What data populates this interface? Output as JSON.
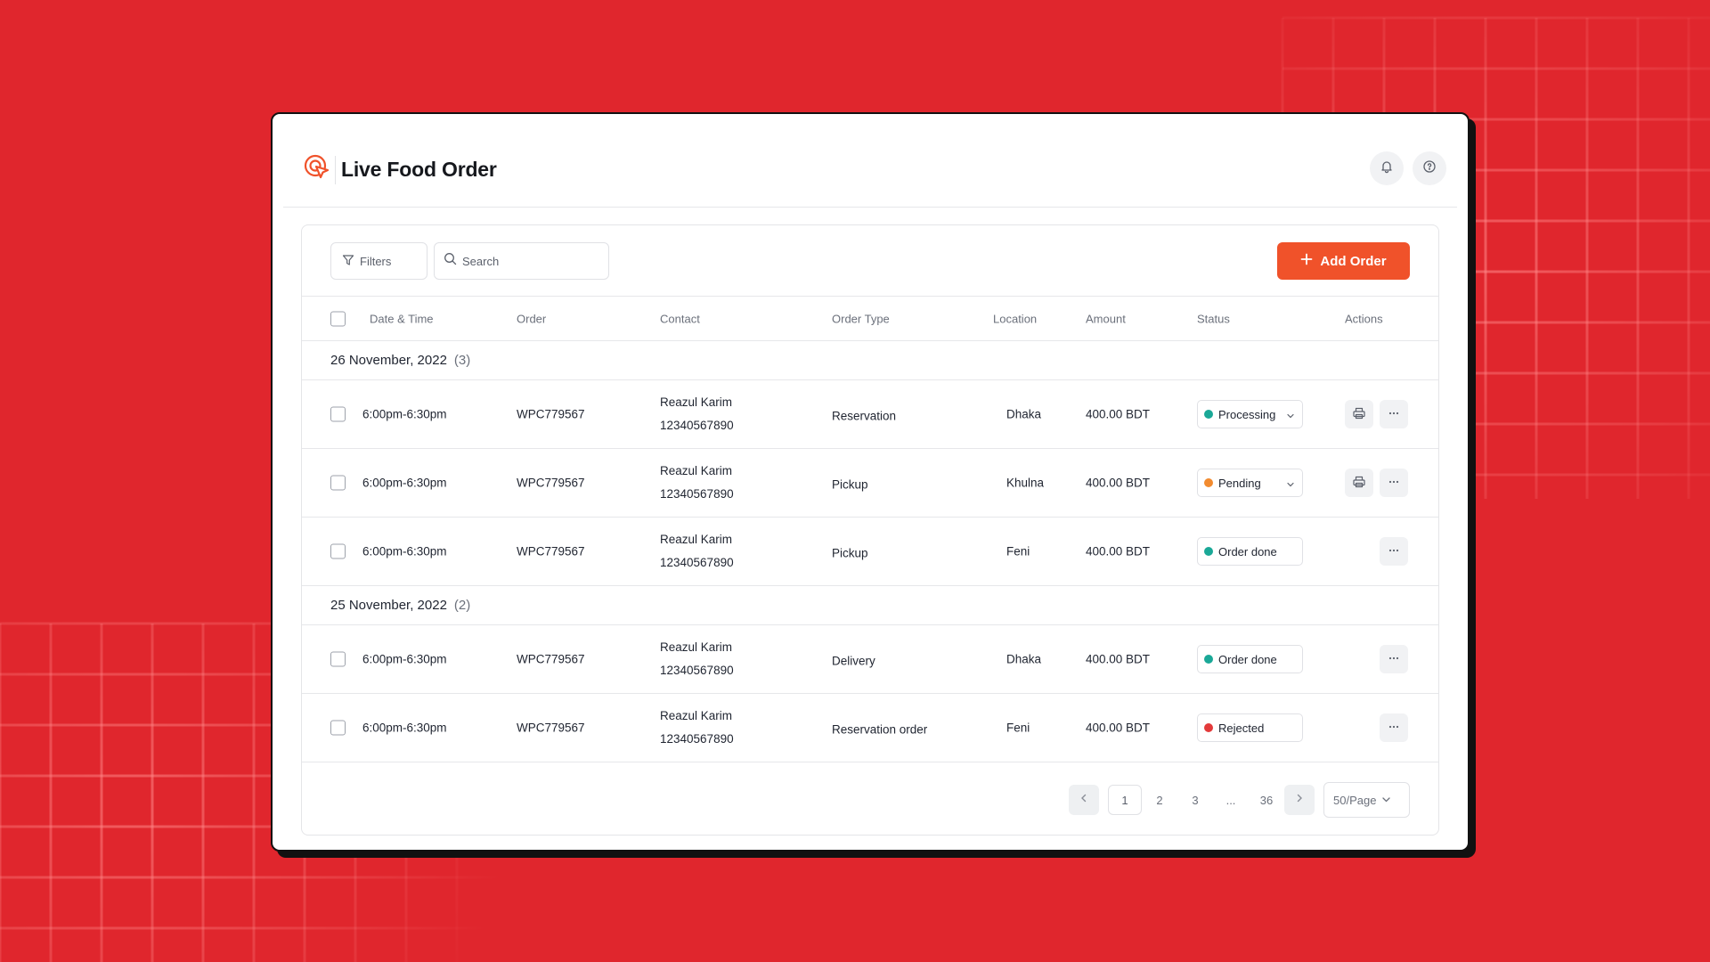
{
  "colors": {
    "background": "#e0262d",
    "accent": "#f0522a",
    "status_processing": "#1aa897",
    "status_pending": "#f28b2f",
    "status_done": "#1aa897",
    "status_rejected": "#e33a3a"
  },
  "app": {
    "title": "Live Food Order",
    "logo_icon": "cursor-target-icon",
    "notification_icon": "bell-icon",
    "help_icon": "help-circle-icon"
  },
  "toolbar": {
    "filters_label": "Filters",
    "search_placeholder": "Search",
    "search_value": "",
    "add_order_label": "Add Order"
  },
  "table": {
    "columns": [
      "Date & Time",
      "Order",
      "Contact",
      "Order Type",
      "Location",
      "Amount",
      "Status",
      "Actions"
    ],
    "groups": [
      {
        "date": "26 November, 2022",
        "count": "(3)",
        "rows": [
          {
            "time": "6:00pm-6:30pm",
            "order": "WPC779567",
            "contact_name": "Reazul Karim",
            "contact_phone": "12340567890",
            "type": "Reservation",
            "location": "Dhaka",
            "amount": "400.00 BDT",
            "status": "Processing",
            "status_color": "#1aa897",
            "has_dropdown": true,
            "has_print": true
          },
          {
            "time": "6:00pm-6:30pm",
            "order": "WPC779567",
            "contact_name": "Reazul Karim",
            "contact_phone": "12340567890",
            "type": "Pickup",
            "location": "Khulna",
            "amount": "400.00 BDT",
            "status": "Pending",
            "status_color": "#f28b2f",
            "has_dropdown": true,
            "has_print": true
          },
          {
            "time": "6:00pm-6:30pm",
            "order": "WPC779567",
            "contact_name": "Reazul Karim",
            "contact_phone": "12340567890",
            "type": "Pickup",
            "location": "Feni",
            "amount": "400.00 BDT",
            "status": "Order done",
            "status_color": "#1aa897",
            "has_dropdown": false,
            "has_print": false
          }
        ]
      },
      {
        "date": "25 November, 2022",
        "count": "(2)",
        "rows": [
          {
            "time": "6:00pm-6:30pm",
            "order": "WPC779567",
            "contact_name": "Reazul Karim",
            "contact_phone": "12340567890",
            "type": "Delivery",
            "location": "Dhaka",
            "amount": "400.00 BDT",
            "status": "Order done",
            "status_color": "#1aa897",
            "has_dropdown": false,
            "has_print": false
          },
          {
            "time": "6:00pm-6:30pm",
            "order": "WPC779567",
            "contact_name": "Reazul Karim",
            "contact_phone": "12340567890",
            "type": "Reservation order",
            "location": "Feni",
            "amount": "400.00 BDT",
            "status": "Rejected",
            "status_color": "#e33a3a",
            "has_dropdown": false,
            "has_print": false
          }
        ]
      }
    ]
  },
  "pagination": {
    "pages": [
      "1",
      "2",
      "3",
      "...",
      "36"
    ],
    "current": "1",
    "per_page": "50/Page"
  }
}
